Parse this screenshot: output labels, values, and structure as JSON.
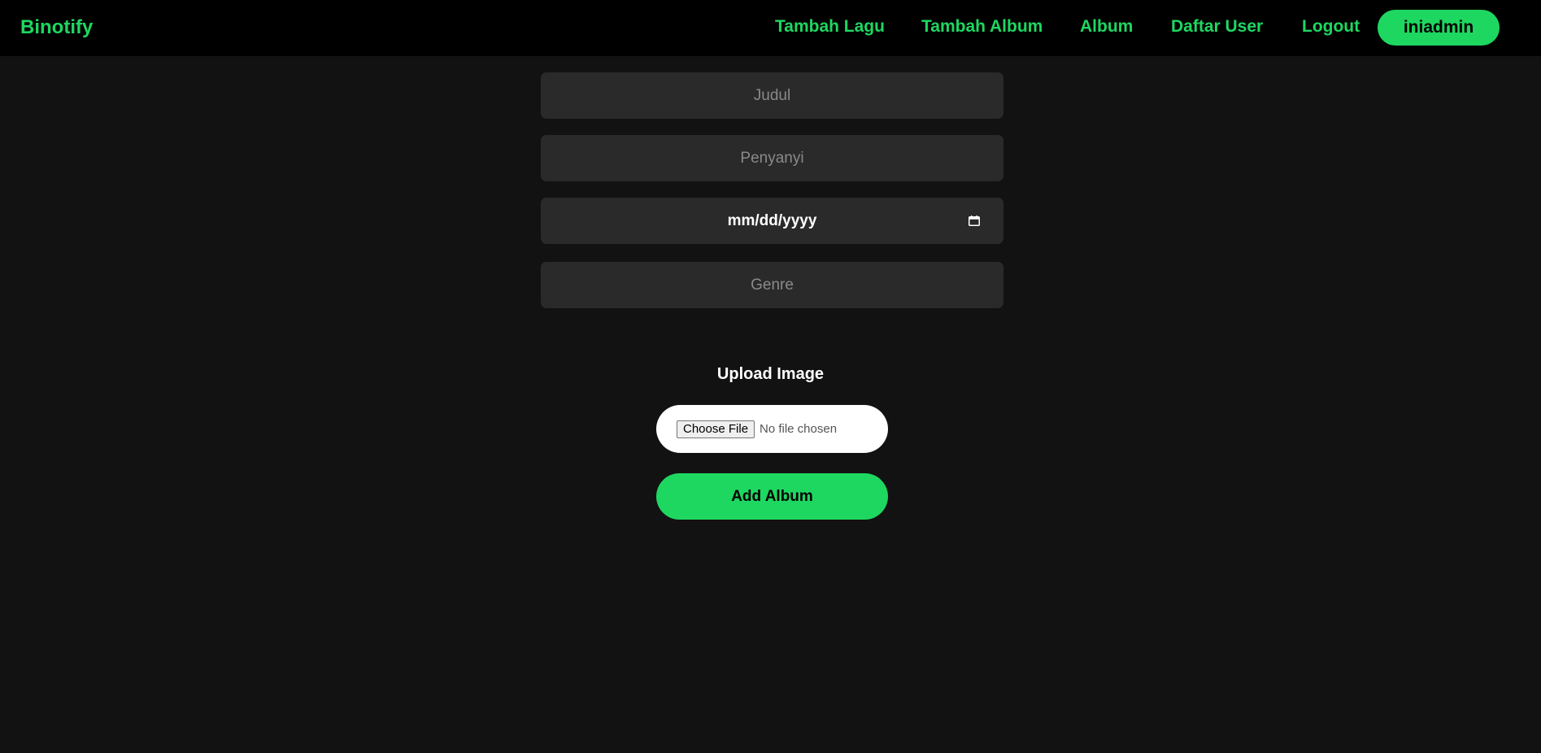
{
  "navbar": {
    "brand": "Binotify",
    "links": [
      {
        "label": "Tambah Lagu"
      },
      {
        "label": "Tambah Album"
      },
      {
        "label": "Album"
      },
      {
        "label": "Daftar User"
      },
      {
        "label": "Logout"
      }
    ],
    "user": "iniadmin"
  },
  "form": {
    "judul_placeholder": "Judul",
    "penyanyi_placeholder": "Penyanyi",
    "date_placeholder": "mm/dd/yyyy",
    "genre_placeholder": "Genre",
    "upload_label": "Upload Image",
    "choose_file_label": "Choose File",
    "file_status": "No file chosen",
    "submit_label": "Add Album"
  },
  "colors": {
    "accent": "#1ed760",
    "background": "#121212",
    "navbar": "#000000",
    "field": "#2a2a2a"
  },
  "icons": {
    "date": "calendar-icon"
  }
}
